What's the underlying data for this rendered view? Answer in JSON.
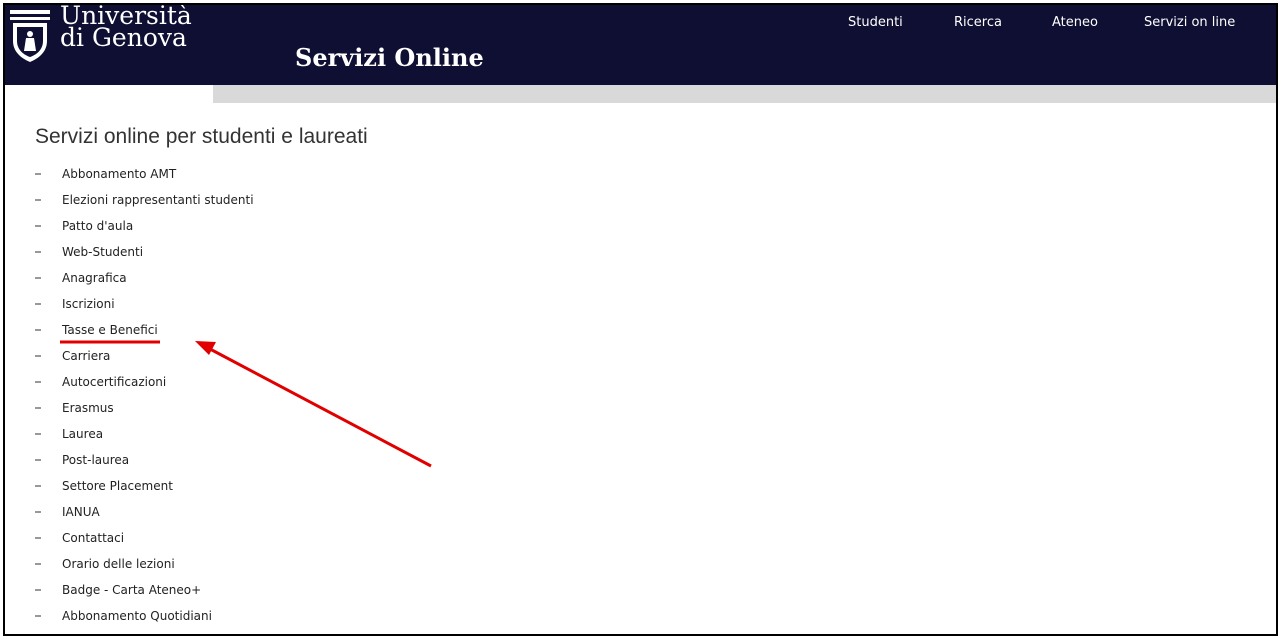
{
  "header": {
    "university_line1": "Università",
    "university_line2": "di Genova",
    "site_title": "Servizi Online",
    "nav": [
      "Studenti",
      "Ricerca",
      "Ateneo",
      "Servizi on line"
    ]
  },
  "main": {
    "heading": "Servizi online per studenti e laureati",
    "menu": [
      "Abbonamento AMT",
      "Elezioni rappresentanti studenti",
      "Patto d'aula",
      "Web-Studenti",
      "Anagrafica",
      "Iscrizioni",
      "Tasse e Benefici",
      "Carriera",
      "Autocertificazioni",
      "Erasmus",
      "Laurea",
      "Post-laurea",
      "Settore Placement",
      "IANUA",
      "Contattaci",
      "Orario delle lezioni",
      "Badge - Carta Ateneo+",
      "Abbonamento Quotidiani"
    ]
  },
  "colors": {
    "header_bg": "#0f0f33",
    "subbar": "#d9d9d9",
    "annotation": "#e00000"
  },
  "icons": {
    "logo": "university-seal-icon"
  }
}
